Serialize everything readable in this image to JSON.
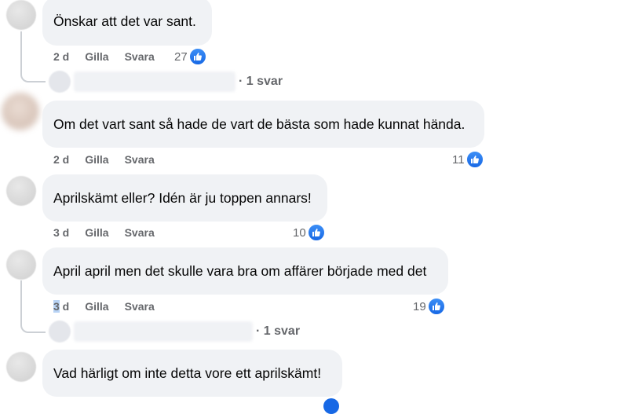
{
  "comments": [
    {
      "text": "Önskar att det var sant.",
      "time": "2 d",
      "like": "Gilla",
      "reply": "Svara",
      "reactions": "27"
    },
    {
      "text": "Om det vart sant så hade de vart de bästa som hade kunnat hända.",
      "time": "2 d",
      "like": "Gilla",
      "reply": "Svara",
      "reactions": "11"
    },
    {
      "text": "Aprilskämt eller? Idén är ju toppen annars!",
      "time": "3 d",
      "like": "Gilla",
      "reply": "Svara",
      "reactions": "10"
    },
    {
      "text": "April april men det skulle vara bra om affärer började med det",
      "time_highlight": "3",
      "time_rest": " d",
      "like": "Gilla",
      "reply": "Svara",
      "reactions": "19"
    },
    {
      "text": "Vad härligt om inte detta vore ett aprilskämt!"
    }
  ],
  "replies": [
    {
      "label": "· 1 svar"
    },
    {
      "label": "· 1 svar"
    }
  ],
  "icons": {
    "like": "thumbs-up-icon"
  },
  "colors": {
    "bubble": "#f0f2f5",
    "like_blue": "#1877f2",
    "meta_gray": "#65676b"
  }
}
